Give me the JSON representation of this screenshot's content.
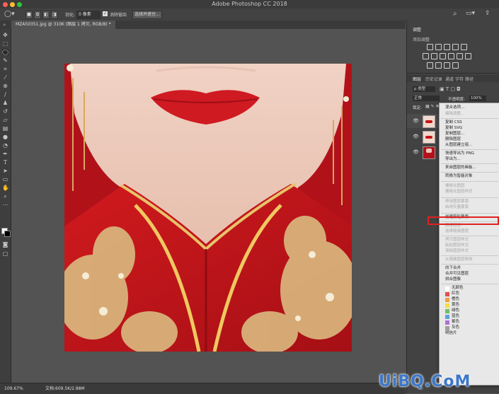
{
  "window": {
    "title": "Adobe Photoshop CC 2018"
  },
  "options_bar": {
    "feather_label": "羽化:",
    "feather_value": "0 像素",
    "antialias_label": "消除锯齿",
    "select_mask_button": "选择并遮住..."
  },
  "document": {
    "tab_label": "MZA50351.jpg @ 310K (图层 1 拷贝, RGB/8) *"
  },
  "status_bar": {
    "zoom": "109.67%",
    "doc_info": "文档:609.5K/2.88M"
  },
  "panels": {
    "adjustments": {
      "tab": "调整",
      "subtitle": "添加调整"
    },
    "layers_tabs": [
      "图层",
      "历史记录",
      "通道",
      "字符",
      "路径"
    ],
    "kind_filter": "ρ 类型",
    "blend_mode": "正常",
    "opacity_label": "不透明度:",
    "opacity_value": "100%",
    "lock_label": "锁定:"
  },
  "context_menu": {
    "items": [
      {
        "label": "混合选项...",
        "enabled": true
      },
      {
        "label": "编辑调整...",
        "enabled": false
      },
      {
        "label": "复制 CSS",
        "enabled": true
      },
      {
        "label": "复制 SVG",
        "enabled": true
      },
      {
        "label": "复制图层...",
        "enabled": true
      },
      {
        "label": "删除图层",
        "enabled": true
      },
      {
        "label": "从图层建立组...",
        "enabled": true
      },
      {
        "label": "快速导出为 PNG",
        "enabled": true
      },
      {
        "label": "导出为...",
        "enabled": true
      },
      {
        "label": "来自图层的画板...",
        "enabled": true
      },
      {
        "label": "转换为智能对象",
        "enabled": true
      },
      {
        "label": "栅格化图层",
        "enabled": false
      },
      {
        "label": "栅格化图层样式",
        "enabled": false
      },
      {
        "label": "停用图层蒙版",
        "enabled": false
      },
      {
        "label": "启用矢量蒙版",
        "enabled": false
      },
      {
        "label": "创建剪贴蒙版",
        "enabled": true,
        "highlighted": true
      },
      {
        "label": "链接图层",
        "enabled": false
      },
      {
        "label": "选择链接图层",
        "enabled": false
      },
      {
        "label": "拷贝图层样式",
        "enabled": false
      },
      {
        "label": "粘贴图层样式",
        "enabled": false
      },
      {
        "label": "清除图层样式",
        "enabled": false
      },
      {
        "label": "从隔离图层释放",
        "enabled": false
      },
      {
        "label": "向下合并",
        "enabled": true
      },
      {
        "label": "合并可见图层",
        "enabled": true
      },
      {
        "label": "拼合图像",
        "enabled": true
      },
      {
        "label": "无颜色",
        "enabled": true,
        "swatch": "#ffffff"
      },
      {
        "label": "红色",
        "enabled": true,
        "swatch": "#e05050"
      },
      {
        "label": "橙色",
        "enabled": true,
        "swatch": "#f0a040"
      },
      {
        "label": "黄色",
        "enabled": true,
        "swatch": "#f0e040"
      },
      {
        "label": "绿色",
        "enabled": true,
        "swatch": "#70c060"
      },
      {
        "label": "蓝色",
        "enabled": true,
        "swatch": "#60a0e0"
      },
      {
        "label": "紫色",
        "enabled": true,
        "swatch": "#b070d0"
      },
      {
        "label": "灰色",
        "enabled": true,
        "swatch": "#a0a0a0"
      },
      {
        "label": "明信片",
        "enabled": true
      }
    ]
  },
  "watermark": {
    "text": "UiBQ.CoM"
  },
  "colors": {
    "traffic_close": "#fe5f57",
    "traffic_min": "#febc2e",
    "traffic_max": "#28c840",
    "photo_red": "#c4131c",
    "highlight_border": "#e02020"
  }
}
